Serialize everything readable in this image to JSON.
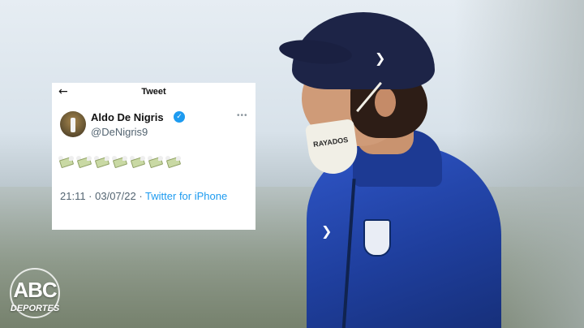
{
  "tweet": {
    "heading": "Tweet",
    "back_icon": "arrow-left-icon",
    "user": {
      "name": "Aldo De Nigris",
      "handle": "@DeNigris9",
      "verified_icon": "verified-badge-icon"
    },
    "more_icon": "more-options-icon",
    "content_emojis": [
      "money-with-wings",
      "money-with-wings",
      "money-with-wings",
      "money-with-wings",
      "money-with-wings",
      "money-with-wings",
      "money-with-wings"
    ],
    "timestamp": "21:11 · 03/07/22 · ",
    "source": "Twitter for iPhone"
  },
  "photo": {
    "cap_logo": "puma-logo-icon",
    "mask_text": "RAYADOS"
  },
  "watermark": {
    "brand": "ABC",
    "sub": "DEPORTES"
  },
  "colors": {
    "verified": "#1d9bf0",
    "link": "#1d9bf0",
    "jacket": "#2f56c8"
  }
}
